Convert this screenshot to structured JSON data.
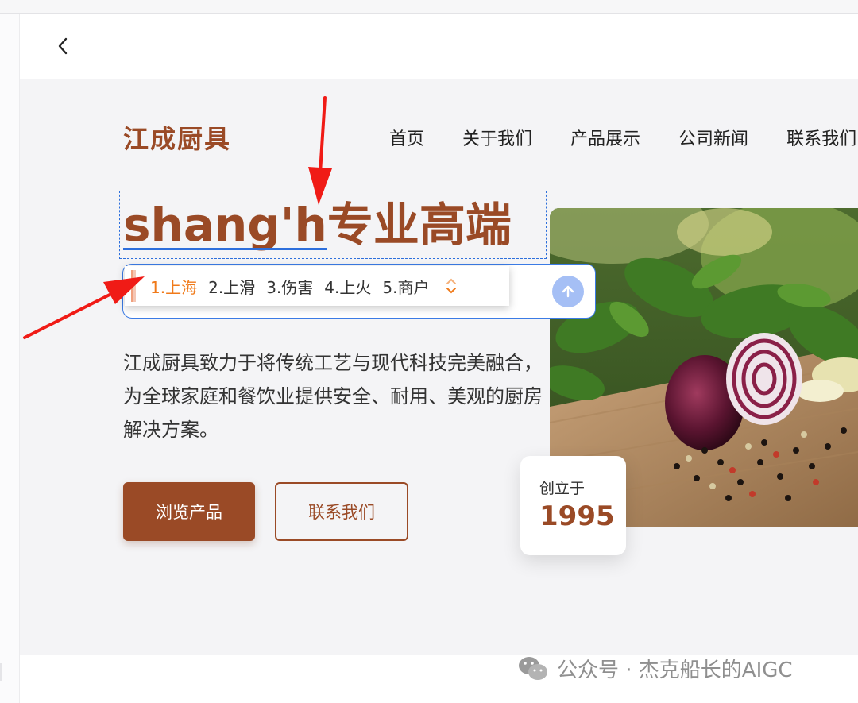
{
  "browser": {
    "back_icon": "chevron-left-icon"
  },
  "site": {
    "logo": "江成厨具",
    "nav": [
      "首页",
      "关于我们",
      "产品展示",
      "公司新闻",
      "联系我们"
    ]
  },
  "hero": {
    "headline_composing": "shang'h",
    "headline_rest": "专业高端",
    "description": "江成厨具致力于将传统工艺与现代科技完美融合，为全球家庭和餐饮业提供安全、耐用、美观的厨房解决方案。",
    "primary_button": "浏览产品",
    "secondary_button": "联系我们",
    "badge_label": "创立于",
    "badge_year": "1995"
  },
  "ime": {
    "candidates": [
      "1.上海",
      "2.上滑",
      "3.伤害",
      "4.上火",
      "5.商户"
    ],
    "active_index": 0,
    "arrows_icon": "chevron-up-down-icon",
    "send_icon": "arrow-up-icon"
  },
  "watermark": {
    "icon": "wechat-icon",
    "text": "公众号 · 杰克船长的AIGC"
  },
  "colors": {
    "brand": "#9a4a26",
    "ime_accent": "#f07a1a",
    "selection": "#2d6fdc",
    "annotation_arrow": "#f01b16"
  }
}
